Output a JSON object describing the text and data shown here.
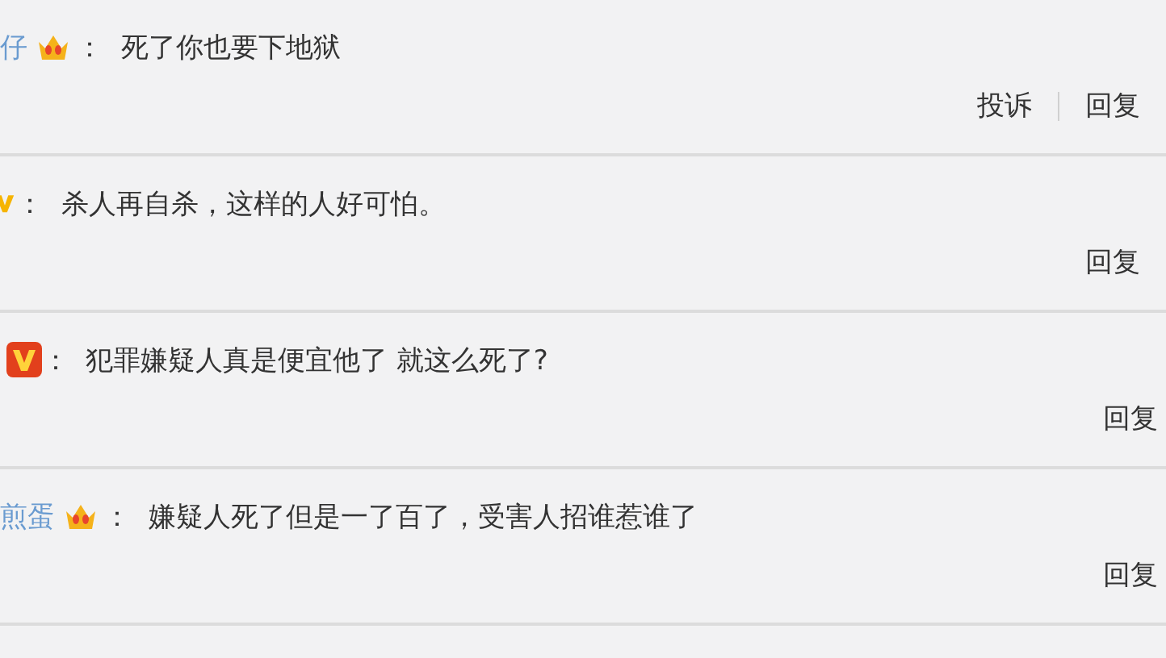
{
  "comments": [
    {
      "user": "仔",
      "badge": {
        "kind": "crown"
      },
      "colon": "：",
      "text": "死了你也要下地狱",
      "actions": [
        "投诉",
        "回复"
      ]
    },
    {
      "badge": {
        "kind": "vyellow"
      },
      "colon": "：",
      "text": "杀人再自杀，这样的人好可怕。",
      "actions": [
        "回复"
      ]
    },
    {
      "badge": {
        "kind": "vred"
      },
      "colon": "：",
      "text": "犯罪嫌疑人真是便宜他了 就这么死了?",
      "actions": [
        "回复"
      ]
    },
    {
      "user": "煎蛋",
      "badge": {
        "kind": "crown"
      },
      "colon": "：",
      "text": "嫌疑人死了但是一了百了，受害人招谁惹谁了",
      "actions": [
        "回复"
      ]
    }
  ]
}
